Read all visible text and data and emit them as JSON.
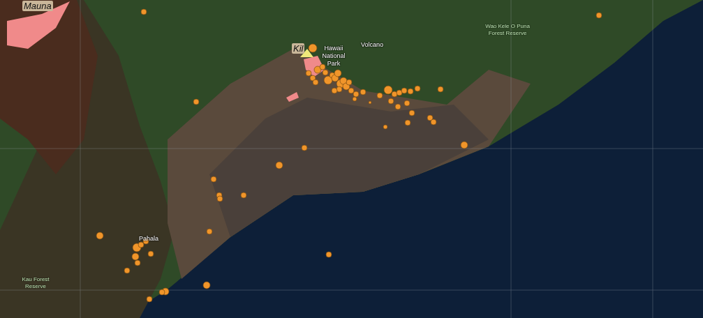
{
  "map": {
    "labels": [
      {
        "text": "Mauna",
        "kind": "peak"
      },
      {
        "text": "Kil",
        "kind": "peak"
      },
      {
        "text": "Hawaii National Park",
        "kind": "place"
      },
      {
        "text": "Volcano",
        "kind": "place"
      },
      {
        "text": "Wao Kele O Puna Forest Reserve",
        "kind": "area"
      },
      {
        "text": "Pahala",
        "kind": "place"
      },
      {
        "text": "Kau Forest Reserve",
        "kind": "area"
      }
    ]
  }
}
